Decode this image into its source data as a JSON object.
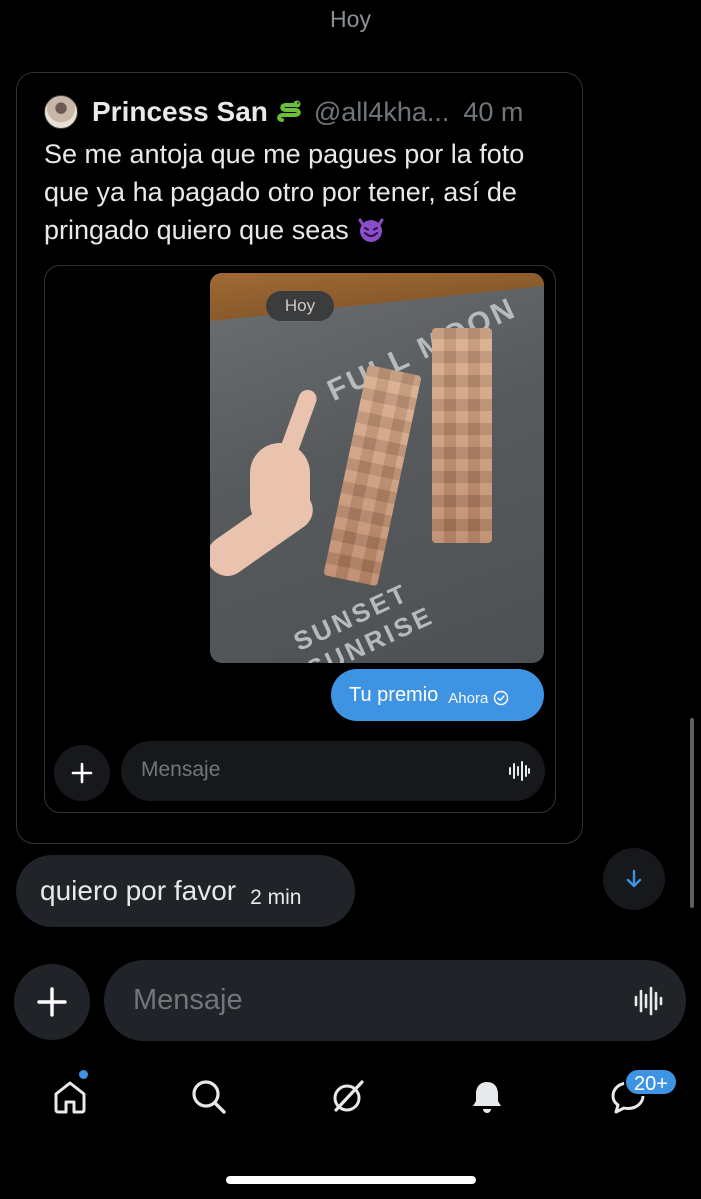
{
  "day_label": "Hoy",
  "quoted_post": {
    "display_name": "Princess San",
    "emoji_after_name": "snake-emoji",
    "handle": "@all4kha...",
    "time": "40 m",
    "text": "Se me antoja que me pagues por la foto que ya ha pagado otro por tener, así de pringado quiero que seas",
    "text_emoji": "smiling-devil-emoji",
    "embedded_screenshot": {
      "day_chip": "Hoy",
      "photo_print_text_1": "FULL MOON",
      "photo_print_text_2": "SUNSET SUNRISE",
      "sent_message": "Tu premio",
      "sent_time": "Ahora",
      "input_placeholder": "Mensaje"
    }
  },
  "received_message": {
    "text": "quiero por favor",
    "time": "2 min"
  },
  "composer": {
    "placeholder": "Mensaje"
  },
  "tabbar": {
    "messages_badge": "20+"
  },
  "colors": {
    "background": "#000000",
    "accent": "#3f93e3",
    "bubble_gray": "#202327",
    "muted_text": "#71767b"
  }
}
